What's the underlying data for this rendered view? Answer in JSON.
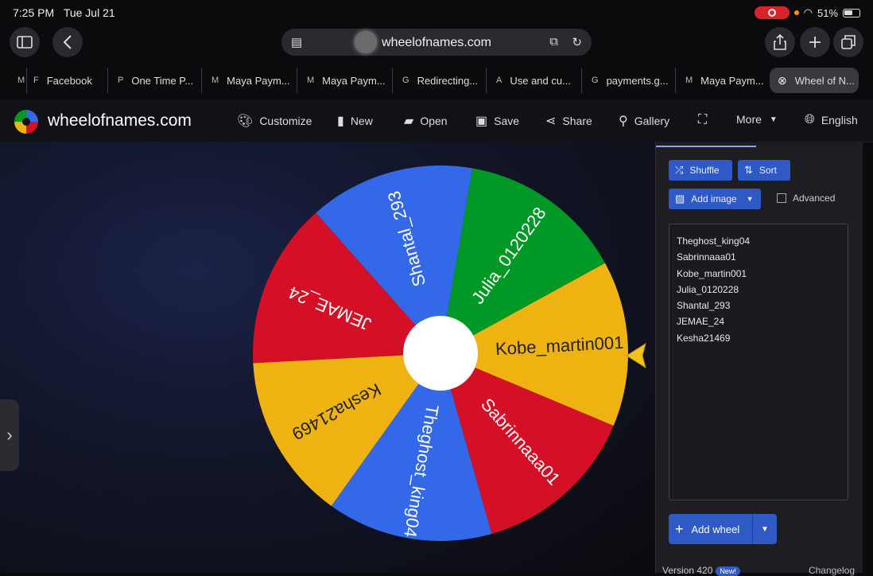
{
  "status": {
    "time": "7:25 PM",
    "date": "Tue Jul 21",
    "battery": "51%"
  },
  "browser": {
    "url": "wheelofnames.com",
    "tabs": [
      {
        "favicon": "M",
        "label": ""
      },
      {
        "favicon": "F",
        "label": "Facebook"
      },
      {
        "favicon": "P",
        "label": "One Time P..."
      },
      {
        "favicon": "M",
        "label": "Maya Paym..."
      },
      {
        "favicon": "M",
        "label": "Maya Paym..."
      },
      {
        "favicon": "G",
        "label": "Redirecting..."
      },
      {
        "favicon": "A",
        "label": "Use and cu..."
      },
      {
        "favicon": "G",
        "label": "payments.g..."
      },
      {
        "favicon": "M",
        "label": "Maya Paym..."
      },
      {
        "favicon": "⊗",
        "label": "Wheel of N..."
      }
    ]
  },
  "site": {
    "title": "wheelofnames.com",
    "menu": {
      "customize": "Customize",
      "new": "New",
      "open": "Open",
      "save": "Save",
      "share": "Share",
      "gallery": "Gallery",
      "more": "More",
      "language": "English"
    }
  },
  "wheel": {
    "segments": [
      {
        "name": "Kobe_martin001",
        "color": "#eeb211"
      },
      {
        "name": "Sabrinnaaa01",
        "color": "#d50f25"
      },
      {
        "name": "Theghost_king04",
        "color": "#3369e8"
      },
      {
        "name": "Kesha21469",
        "color": "#eeb211"
      },
      {
        "name": "JEMAE_24",
        "color": "#d50f25"
      },
      {
        "name": "Shantal_293",
        "color": "#3369e8"
      },
      {
        "name": "Julia_0120228",
        "color": "#009925"
      }
    ]
  },
  "panel": {
    "shuffle": "Shuffle",
    "sort": "Sort",
    "add_image": "Add image",
    "advanced": "Advanced",
    "entries": [
      "Theghost_king04",
      "Sabrinnaaa01",
      "Kobe_martin001",
      "Julia_0120228",
      "Shantal_293",
      "JEMAE_24",
      "Kesha21469"
    ],
    "add_wheel": "Add wheel",
    "version": "Version 420",
    "new_badge": "New!",
    "changelog": "Changelog"
  }
}
